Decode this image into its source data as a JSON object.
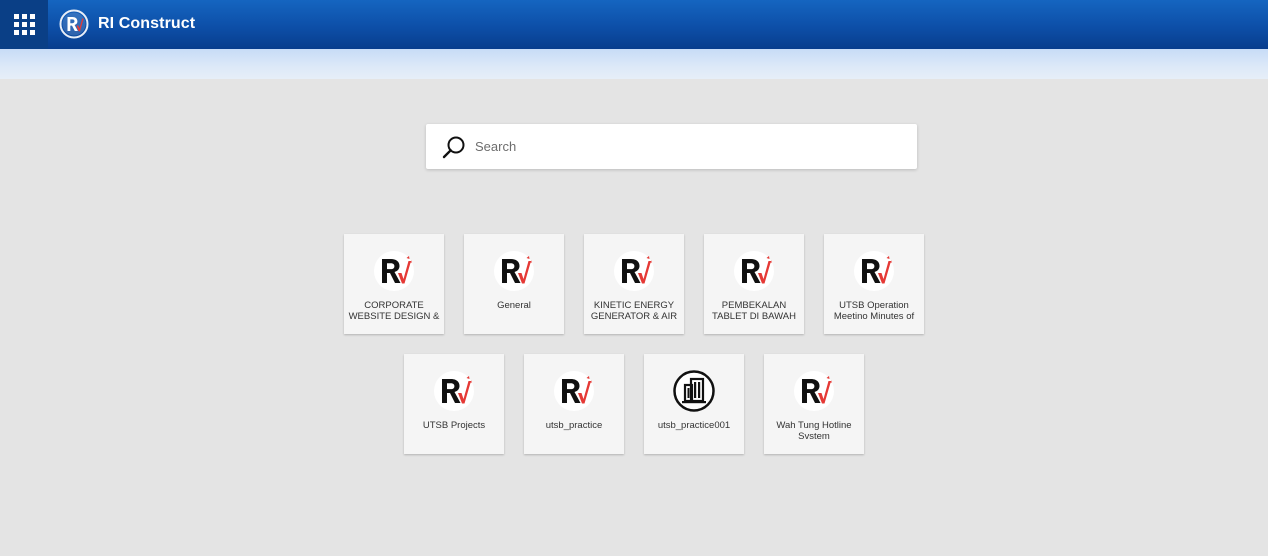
{
  "header": {
    "title": "RI Construct",
    "apps_icon": "grid-icon",
    "logo_icon": "ri-logo-icon",
    "colors": {
      "bar_start": "#1565c0",
      "bar_end": "#083d8d",
      "apps_bg": "#0a3f86"
    }
  },
  "search": {
    "placeholder": "Search",
    "value": "",
    "icon": "search-icon"
  },
  "projects": [
    {
      "label": "CORPORATE WEBSITE DESIGN &",
      "icon": "ri-logo-icon"
    },
    {
      "label": "General",
      "icon": "ri-logo-icon"
    },
    {
      "label": "KINETIC ENERGY GENERATOR & AIR",
      "icon": "ri-logo-icon"
    },
    {
      "label": "PEMBEKALAN TABLET DI BAWAH",
      "icon": "ri-logo-icon"
    },
    {
      "label": "UTSB Operation Meetino Minutes of",
      "icon": "ri-logo-icon"
    },
    {
      "label": "UTSB Projects",
      "icon": "ri-logo-icon"
    },
    {
      "label": "utsb_practice",
      "icon": "ri-logo-icon"
    },
    {
      "label": "utsb_practice001",
      "icon": "building-icon"
    },
    {
      "label": "Wah Tung Hotline Svstem",
      "icon": "ri-logo-icon"
    }
  ]
}
